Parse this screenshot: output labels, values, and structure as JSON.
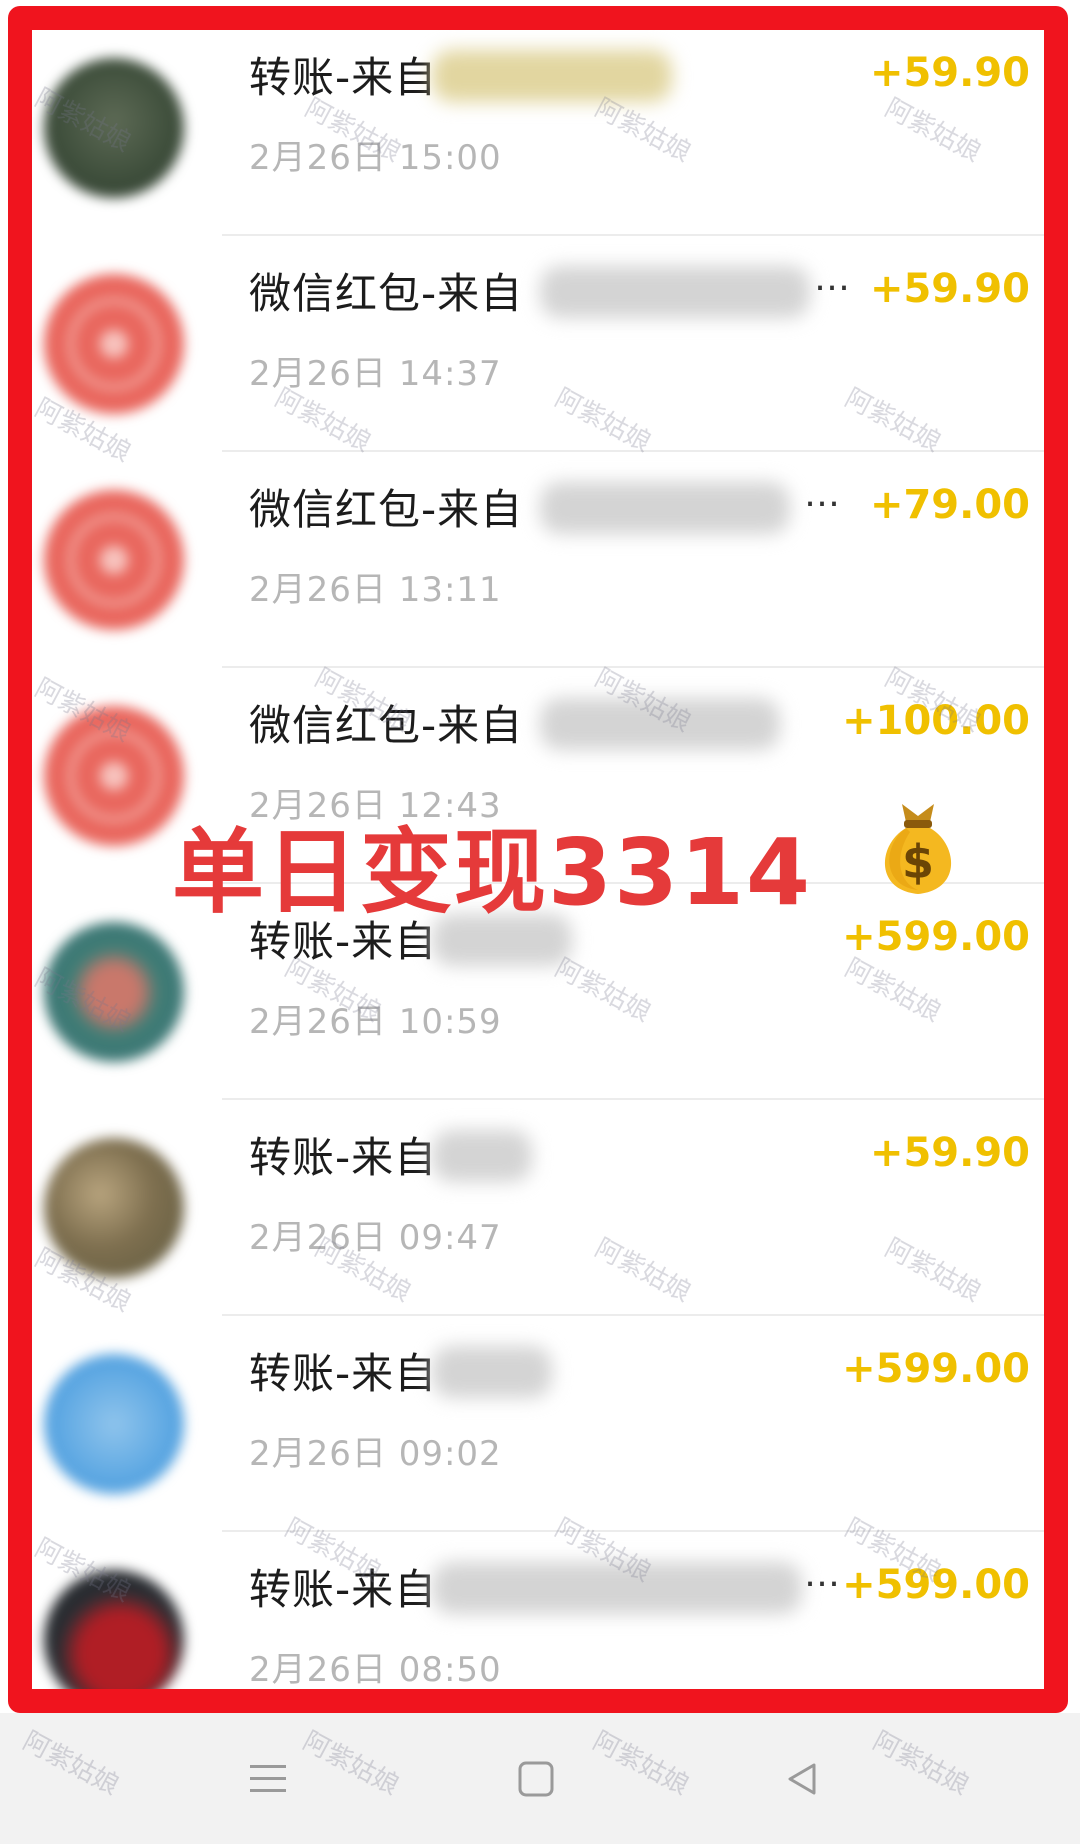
{
  "transactions": [
    {
      "title": "转账-来自",
      "date": "2月26日 15:00",
      "amount": "+59.90",
      "avatar": "blurred-photo"
    },
    {
      "title": "微信红包-来自",
      "date": "2月26日 14:37",
      "amount": "+59.90",
      "avatar": "red-packet",
      "ellipsis": "…"
    },
    {
      "title": "微信红包-来自",
      "date": "2月26日 13:11",
      "amount": "+79.00",
      "avatar": "red-packet",
      "ellipsis": "…"
    },
    {
      "title": "微信红包-来自",
      "date": "2月26日 12:43",
      "amount": "+100.00",
      "avatar": "red-packet"
    },
    {
      "title": "转账-来自",
      "date": "2月26日 10:59",
      "amount": "+599.00",
      "avatar": "blurred-photo"
    },
    {
      "title": "转账-来自",
      "date": "2月26日 09:47",
      "amount": "+59.90",
      "avatar": "blurred-photo"
    },
    {
      "title": "转账-来自",
      "date": "2月26日 09:02",
      "amount": "+599.00",
      "avatar": "blurred-photo"
    },
    {
      "title": "转账-来自",
      "date": "2月26日 08:50",
      "amount": "+599.00",
      "avatar": "blurred-photo",
      "ellipsis": "…"
    }
  ],
  "banner": {
    "text": "单日变现3314",
    "icon": "money-bag-icon"
  },
  "watermark": {
    "small_text": "阿紫姑娘",
    "big_chars": [
      "阿",
      "紫",
      "姑",
      "娘"
    ]
  },
  "navbar": {
    "icons": [
      "menu-icon",
      "home-square-icon",
      "back-triangle-icon"
    ]
  },
  "colors": {
    "frame": "#f0141e",
    "amount": "#f0c000",
    "banner": "#e53a3a",
    "date": "#b6b6b6"
  }
}
